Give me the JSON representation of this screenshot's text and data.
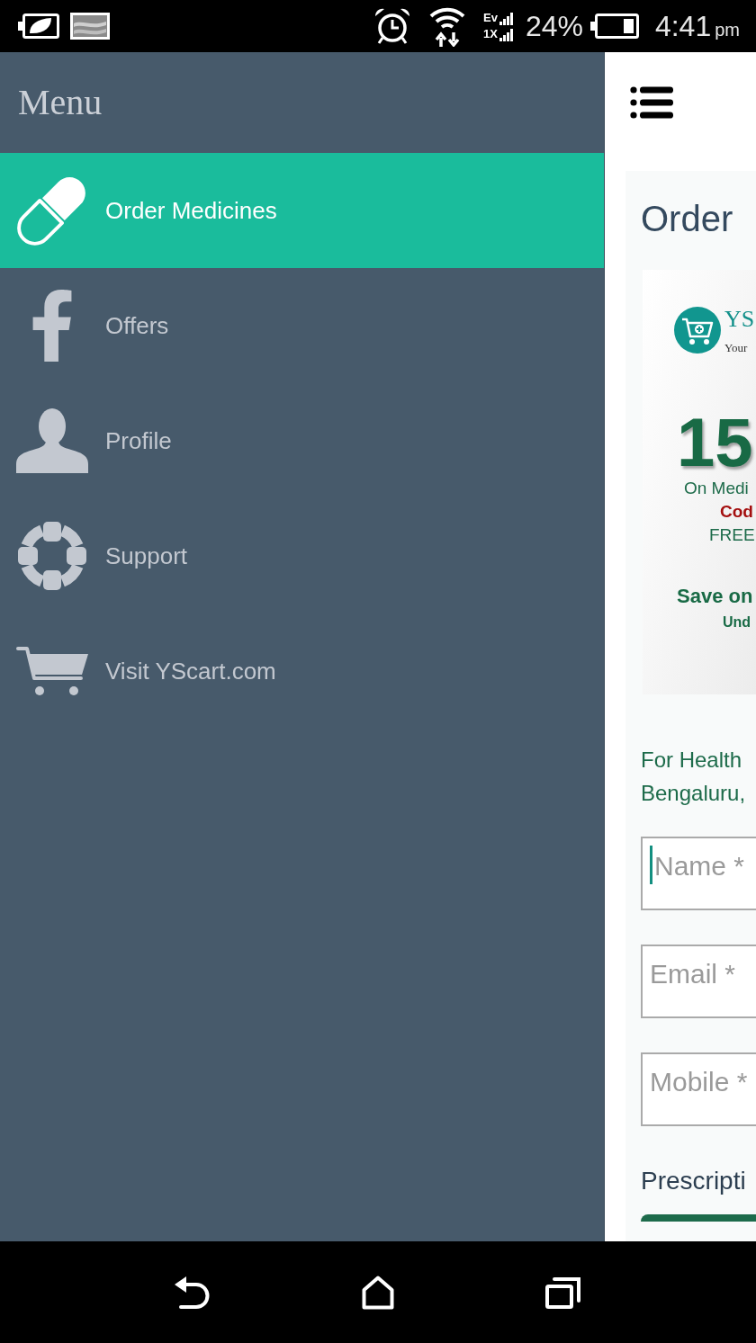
{
  "status_bar": {
    "network": [
      "Ev",
      "1X"
    ],
    "battery_text": "24%",
    "time": "4:41",
    "time_period": "pm"
  },
  "drawer": {
    "title": "Menu",
    "items": [
      {
        "label": "Order Medicines",
        "selected": true
      },
      {
        "label": "Offers",
        "selected": false
      },
      {
        "label": "Profile",
        "selected": false
      },
      {
        "label": "Support",
        "selected": false
      },
      {
        "label": "Visit YScart.com",
        "selected": false
      }
    ]
  },
  "main": {
    "title": "Order",
    "banner": {
      "brand": "YS",
      "tagline": "Your",
      "discount": "15",
      "lines": [
        {
          "text": "On Medi",
          "kind": "plain"
        },
        {
          "text": "Cod",
          "kind": "code"
        },
        {
          "text": "FREE",
          "kind": "plain"
        }
      ],
      "headline": "Save on",
      "subline": "Und"
    },
    "intro": "For Health Bengaluru,",
    "fields": [
      {
        "placeholder": "Name *",
        "focused": true
      },
      {
        "placeholder": "Email *",
        "focused": false
      },
      {
        "placeholder": "Mobile *",
        "focused": false
      }
    ],
    "section_title": "Prescripti"
  }
}
